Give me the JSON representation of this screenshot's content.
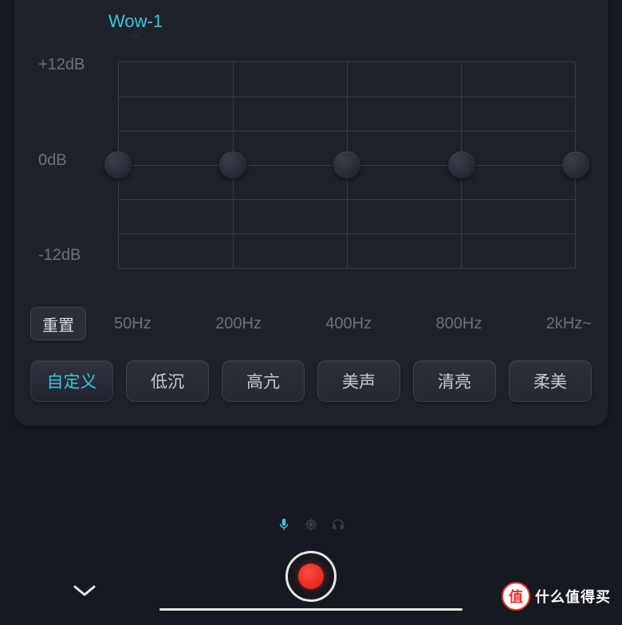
{
  "header": {
    "active_tab": "Wow-1"
  },
  "equalizer": {
    "db_labels": [
      "+12dB",
      "0dB",
      "-12dB"
    ],
    "freq_labels": [
      "50Hz",
      "200Hz",
      "400Hz",
      "800Hz",
      "2kHz~"
    ],
    "sliders": [
      {
        "freq": "50Hz",
        "value_db": 0
      },
      {
        "freq": "200Hz",
        "value_db": 0
      },
      {
        "freq": "400Hz",
        "value_db": 0
      },
      {
        "freq": "800Hz",
        "value_db": 0
      },
      {
        "freq": "2kHz",
        "value_db": 0
      }
    ],
    "reset_label": "重置"
  },
  "presets": {
    "items": [
      {
        "label": "自定义",
        "active": true
      },
      {
        "label": "低沉",
        "active": false
      },
      {
        "label": "高亢",
        "active": false
      },
      {
        "label": "美声",
        "active": false
      },
      {
        "label": "清亮",
        "active": false
      },
      {
        "label": "柔美",
        "active": false
      }
    ]
  },
  "status": {
    "mic": "on",
    "chip": "off",
    "headphone": "off"
  },
  "watermark": {
    "badge_char": "值",
    "text": "什么值得买"
  }
}
